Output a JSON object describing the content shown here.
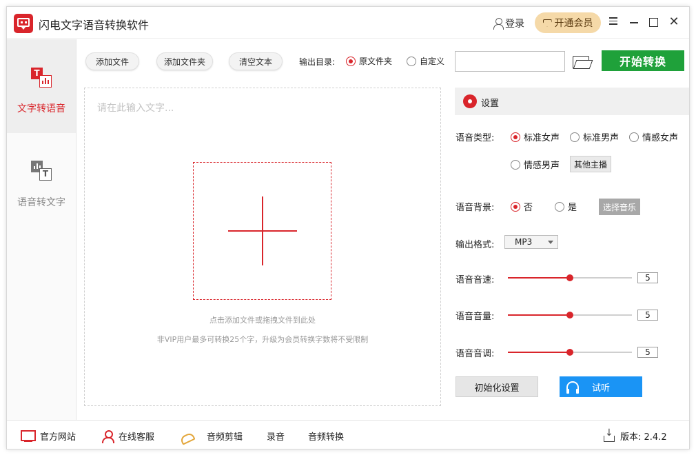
{
  "app": {
    "title": "闪电文字语音转换软件",
    "login_label": "登录",
    "vip_label": "开通会员"
  },
  "sidebar": {
    "items": [
      {
        "label": "文字转语音",
        "active": true,
        "icon": "text-to-speech-icon"
      },
      {
        "label": "语音转文字",
        "active": false,
        "icon": "speech-to-text-icon"
      }
    ]
  },
  "toolbar": {
    "add_file": "添加文件",
    "add_folder": "添加文件夹",
    "clear_text": "清空文本",
    "output_dir_label": "输出目录:",
    "output_options": [
      {
        "label": "原文件夹",
        "checked": true
      },
      {
        "label": "自定义",
        "checked": false
      }
    ],
    "output_path_value": "",
    "start_label": "开始转换"
  },
  "editor": {
    "placeholder": "请在此输入文字...",
    "drop_hint": "点击添加文件或拖拽文件到此处",
    "limit_hint": "非VIP用户最多可转换25个字，升级为会员转换字数将不受限制"
  },
  "settings": {
    "title": "设置",
    "voice_type_label": "语音类型:",
    "voice_types": [
      {
        "label": "标准女声",
        "checked": true
      },
      {
        "label": "标准男声",
        "checked": false
      },
      {
        "label": "情感女声",
        "checked": false
      },
      {
        "label": "情感男声",
        "checked": false
      }
    ],
    "other_voices": "其他主播",
    "background_label": "语音背景:",
    "background_options": [
      {
        "label": "否",
        "checked": true
      },
      {
        "label": "是",
        "checked": false
      }
    ],
    "choose_music": "选择音乐",
    "format_label": "输出格式:",
    "format_value": "MP3",
    "speed_label": "语音音速:",
    "speed_value": "5",
    "volume_label": "语音音量:",
    "volume_value": "5",
    "pitch_label": "语音音调:",
    "pitch_value": "5",
    "slider_fraction": 0.5,
    "reset_label": "初始化设置",
    "listen_label": "试听"
  },
  "footer": {
    "website": "官方网站",
    "support": "在线客服",
    "audio_edit": "音频剪辑",
    "record": "录音",
    "audio_convert": "音频转换",
    "version": "版本: 2.4.2"
  },
  "colors": {
    "accent": "#d9252b",
    "start_green": "#1fa13a",
    "listen_blue": "#1a94f5",
    "vip_gold": "#f5d9a8"
  }
}
